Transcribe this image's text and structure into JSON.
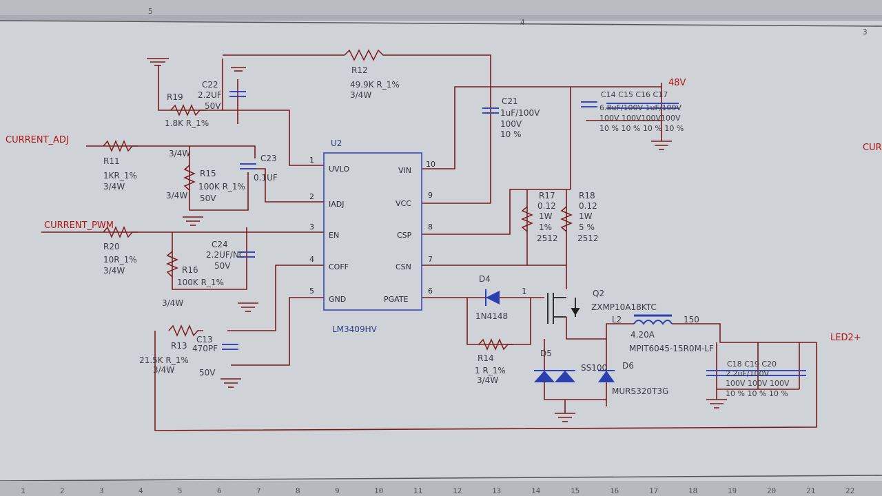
{
  "sheet": {
    "top_zone_labels": [
      "5",
      "4",
      "3"
    ],
    "bottom_ruler": [
      "1",
      "2",
      "3",
      "4",
      "5",
      "6",
      "7",
      "8",
      "9",
      "10",
      "11",
      "12",
      "13",
      "14",
      "15",
      "16",
      "17",
      "18",
      "19",
      "20",
      "21",
      "22"
    ]
  },
  "nets": {
    "current_adj": "CURRENT_ADJ",
    "current_pwm": "CURRENT_PWM",
    "v48": "48V",
    "led": "LED2+",
    "right_cut": "CUR"
  },
  "ic": {
    "ref": "U2",
    "part": "LM3409HV",
    "left_pins": [
      {
        "num": "1",
        "name": "UVLO"
      },
      {
        "num": "2",
        "name": "IADJ"
      },
      {
        "num": "3",
        "name": "EN"
      },
      {
        "num": "4",
        "name": "COFF"
      },
      {
        "num": "5",
        "name": "GND"
      }
    ],
    "right_pins": [
      {
        "num": "10",
        "name": "VIN"
      },
      {
        "num": "9",
        "name": "VCC"
      },
      {
        "num": "8",
        "name": "CSP"
      },
      {
        "num": "7",
        "name": "CSN"
      },
      {
        "num": "6",
        "name": "PGATE"
      }
    ]
  },
  "components": {
    "r12": {
      "ref": "R12",
      "value": "49.9K R_1%",
      "power": "3/4W"
    },
    "r19": {
      "ref": "R19",
      "value": "1.8K R_1%"
    },
    "c22": {
      "ref": "C22",
      "value": "2.2UF",
      "volt": "50V"
    },
    "r11": {
      "ref": "R11",
      "value": "1KR_1%",
      "power": "3/4W",
      "power_top": "3/4W"
    },
    "r15": {
      "ref": "R15",
      "value": "100K R_1%",
      "volt": "50V",
      "power": "3/4W"
    },
    "c23": {
      "ref": "C23",
      "value": "0.1UF"
    },
    "r20": {
      "ref": "R20",
      "value": "10R_1%",
      "power": "3/4W"
    },
    "r16": {
      "ref": "R16",
      "value": "100K R_1%",
      "power": "3/4W"
    },
    "c24": {
      "ref": "C24",
      "value": "2.2UF/NC",
      "volt": "50V"
    },
    "r13": {
      "ref": "R13",
      "value": "21.5K R_1%",
      "power": "3/4W"
    },
    "c13": {
      "ref": "C13",
      "value": "470PF",
      "volt": "50V"
    },
    "c21": {
      "ref": "C21",
      "value": "1uF/100V",
      "volt": "100V",
      "tol": "10 %"
    },
    "c14_17": {
      "refs": "C14  C15  C16  C17",
      "value": "6.8uF/100V 1uF/100V",
      "volt": "100V  100V100V100V",
      "tol": "10 %   10 %  10 % 10 %"
    },
    "r17": {
      "ref": "R17",
      "value": "0.12",
      "power": "1W",
      "tol": "1%",
      "pkg": "2512"
    },
    "r18": {
      "ref": "R18",
      "value": "0.12",
      "power": "1W",
      "tol": "5 %",
      "pkg": "2512"
    },
    "d4": {
      "ref": "D4",
      "part": "1N4148",
      "pin": "1"
    },
    "r14": {
      "ref": "R14",
      "value": "1 R_1%",
      "power": "3/4W"
    },
    "q2": {
      "ref": "Q2",
      "part": "ZXMP10A18KTC"
    },
    "l2": {
      "ref": "L2",
      "value": "4.20A",
      "num": "150",
      "part": "MPIT6045-15R0M-LF"
    },
    "d5": {
      "ref": "D5",
      "part": "SS100"
    },
    "d6": {
      "ref": "D6",
      "part": "MURS320T3G"
    },
    "c18_20": {
      "refs": "C18      C19      C20",
      "value": "2.2uF/100V",
      "volt": "100V      100V      100V",
      "tol": "10 %      10 %      10 %"
    }
  },
  "colors": {
    "wire": "#7a1a1a",
    "chip_outline": "#3a48b8",
    "net_label": "#b11616",
    "background": "#cfd2d6"
  }
}
